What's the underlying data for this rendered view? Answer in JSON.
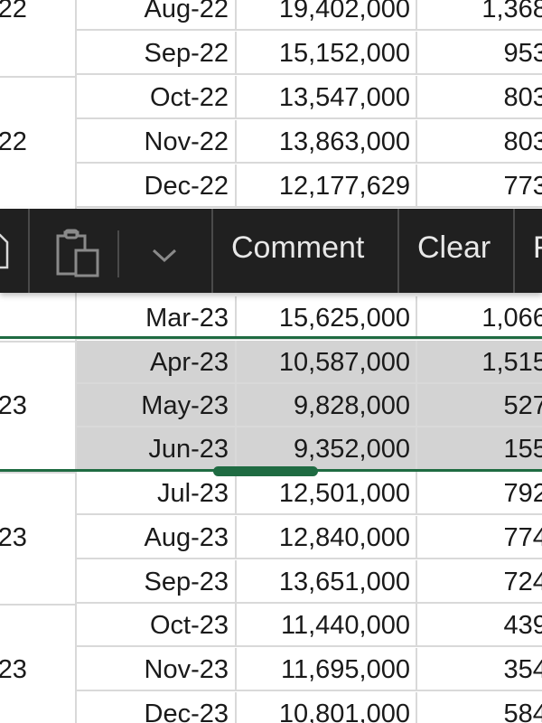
{
  "sheet": {
    "rows": [
      {
        "month": "Aug-22",
        "value": "19,402,000",
        "partial": "1,368,"
      },
      {
        "month": "Sep-22",
        "value": "15,152,000",
        "partial": "953,"
      },
      {
        "month": "Oct-22",
        "value": "13,547,000",
        "partial": "803,"
      },
      {
        "month": "Nov-22",
        "value": "13,863,000",
        "partial": "803,"
      },
      {
        "month": "Dec-22",
        "value": "12,177,629",
        "partial": "773,"
      },
      {
        "month": "Mar-23",
        "value": "15,625,000",
        "partial": "1,066,"
      },
      {
        "month": "Apr-23",
        "value": "10,587,000",
        "partial": "1,515,"
      },
      {
        "month": "May-23",
        "value": "9,828,000",
        "partial": "527,"
      },
      {
        "month": "Jun-23",
        "value": "9,352,000",
        "partial": "155,"
      },
      {
        "month": "Jul-23",
        "value": "12,501,000",
        "partial": "792,"
      },
      {
        "month": "Aug-23",
        "value": "12,840,000",
        "partial": "774,"
      },
      {
        "month": "Sep-23",
        "value": "13,651,000",
        "partial": "724,"
      },
      {
        "month": "Oct-23",
        "value": "11,440,000",
        "partial": "439,"
      },
      {
        "month": "Nov-23",
        "value": "11,695,000",
        "partial": "354,"
      },
      {
        "month": "Dec-23",
        "value": "10,801,000",
        "partial": "584,"
      }
    ],
    "quarters": [
      "-22",
      "-22",
      "-23",
      "-23",
      "-23"
    ],
    "selected_months": [
      "Apr-23",
      "May-23",
      "Jun-23"
    ]
  },
  "toolbar": {
    "comment_label": "Comment",
    "clear_label": "Clear",
    "partial_label": "F",
    "icons": [
      "document-icon",
      "paste-icon",
      "chevron-down-icon"
    ]
  },
  "colors": {
    "toolbar_bg": "#202020",
    "selection_border": "#1f6b42",
    "selection_fill": "#d3d3d3",
    "grid": "#d9d9d9"
  }
}
